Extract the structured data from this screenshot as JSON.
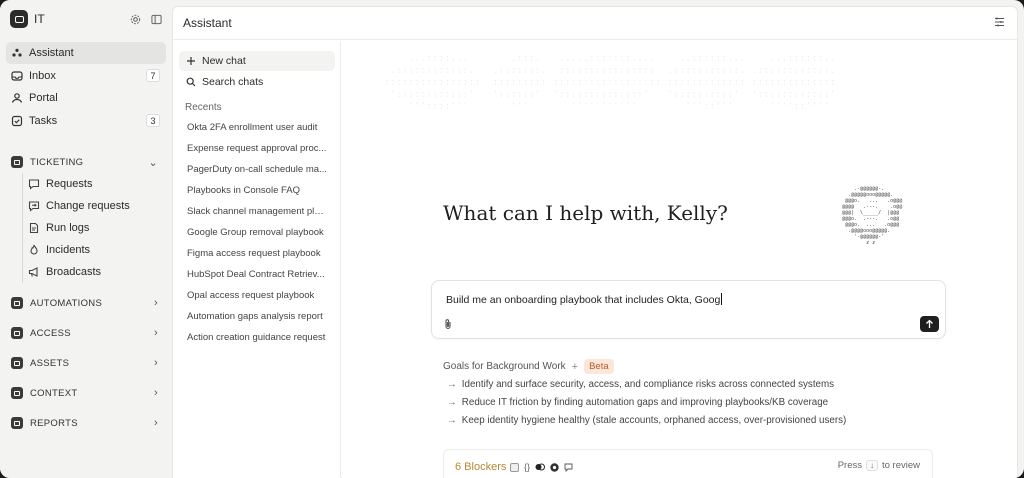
{
  "workspace": {
    "name": "IT",
    "settings_icon": "gear-icon",
    "toggle_icon": "sidebar-toggle-icon"
  },
  "nav": [
    {
      "label": "Assistant",
      "icon": "assistant-icon",
      "badge": ""
    },
    {
      "label": "Inbox",
      "icon": "inbox-icon",
      "badge": "7"
    },
    {
      "label": "Portal",
      "icon": "portal-icon",
      "badge": ""
    },
    {
      "label": "Tasks",
      "icon": "tasks-icon",
      "badge": "3"
    }
  ],
  "sections": {
    "ticketing": {
      "label": "TICKETING",
      "items": [
        "Requests",
        "Change requests",
        "Run logs",
        "Incidents",
        "Broadcasts"
      ]
    },
    "automations": {
      "label": "AUTOMATIONS"
    },
    "access": {
      "label": "ACCESS"
    },
    "assets": {
      "label": "ASSETS"
    },
    "context": {
      "label": "CONTEXT"
    },
    "reports": {
      "label": "REPORTS"
    }
  },
  "header": {
    "title": "Assistant"
  },
  "chat_panel": {
    "new_chat": "New chat",
    "search_chats": "Search chats",
    "recents_label": "Recents",
    "recents": [
      "Okta 2FA enrollment user audit",
      "Expense request approval proc...",
      "PagerDuty on-call schedule ma...",
      "Playbooks in Console FAQ",
      "Slack channel management pla...",
      "Google Group removal playbook",
      "Figma access request playbook",
      "HubSpot Deal Contract Retriev...",
      "Opal access request playbook",
      "Automation gaps analysis report",
      "Action creation guidance request"
    ]
  },
  "main": {
    "greeting": "What can I help with, Kelly?",
    "composer_value": "Build me an onboarding playbook that includes Okta, Goog",
    "goals_title": "Goals for Background Work",
    "beta": "Beta",
    "goals": [
      "Identify and surface security, access, and compliance risks across connected systems",
      "Reduce IT friction by finding automation gaps and improving playbooks/KB coverage",
      "Keep identity hygiene healthy (stale accounts, orphaned access, over-provisioned users)"
    ],
    "blockers_label": "6 Blockers",
    "press": "Press",
    "key": "↓",
    "to_review": "to review"
  },
  "colors": {
    "accent_beta": "#b65a2a",
    "blockers": "#b58a36"
  }
}
